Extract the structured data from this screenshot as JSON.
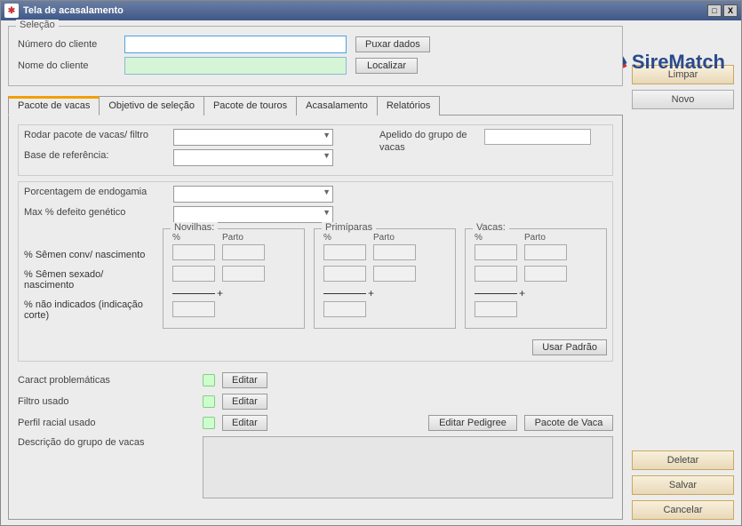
{
  "window": {
    "title": "Tela de acasalamento"
  },
  "logo": {
    "text": "SireMatch"
  },
  "selection": {
    "legend": "Seleção",
    "numero_label": "Número do cliente",
    "numero_value": "",
    "nome_label": "Nome do cliente",
    "nome_value": "",
    "puxar_dados": "Puxar dados",
    "localizar": "Localizar"
  },
  "tabs": [
    {
      "label": "Pacote de vacas"
    },
    {
      "label": "Objetivo de seleção"
    },
    {
      "label": "Pacote de touros"
    },
    {
      "label": "Acasalamento"
    },
    {
      "label": "Relatórios"
    }
  ],
  "panel": {
    "rodar_label": "Rodar pacote de vacas/ filtro",
    "base_label": "Base de referência:",
    "apelido_label": "Apelido do grupo de vacas",
    "apelido_value": "",
    "endogamia_label": "Porcentagem de endogamia",
    "defeito_label": "Max % defeito genético",
    "group_novilhas": "Novilhas:",
    "group_primiparas": "Primíparas",
    "group_vacas": "Vacas:",
    "col_pct": "%",
    "col_parto": "Parto",
    "row_conv": "% Sêmen conv/ nascimento",
    "row_sexado": "% Sêmen sexado/ nascimento",
    "row_nao": "% não indicados (indicação corte)",
    "usar_padrao": "Usar Padrão",
    "caract_label": "Caract problemáticas",
    "filtro_label": "Filtro usado",
    "perfil_label": "Perfil racial usado",
    "descricao_label": "Descrição do grupo de vacas",
    "descricao_value": "",
    "editar": "Editar",
    "editar_pedigree": "Editar Pedigree",
    "pacote_vaca": "Pacote de Vaca"
  },
  "side": {
    "limpar": "Limpar",
    "novo": "Novo",
    "deletar": "Deletar",
    "salvar": "Salvar",
    "cancelar": "Cancelar"
  }
}
